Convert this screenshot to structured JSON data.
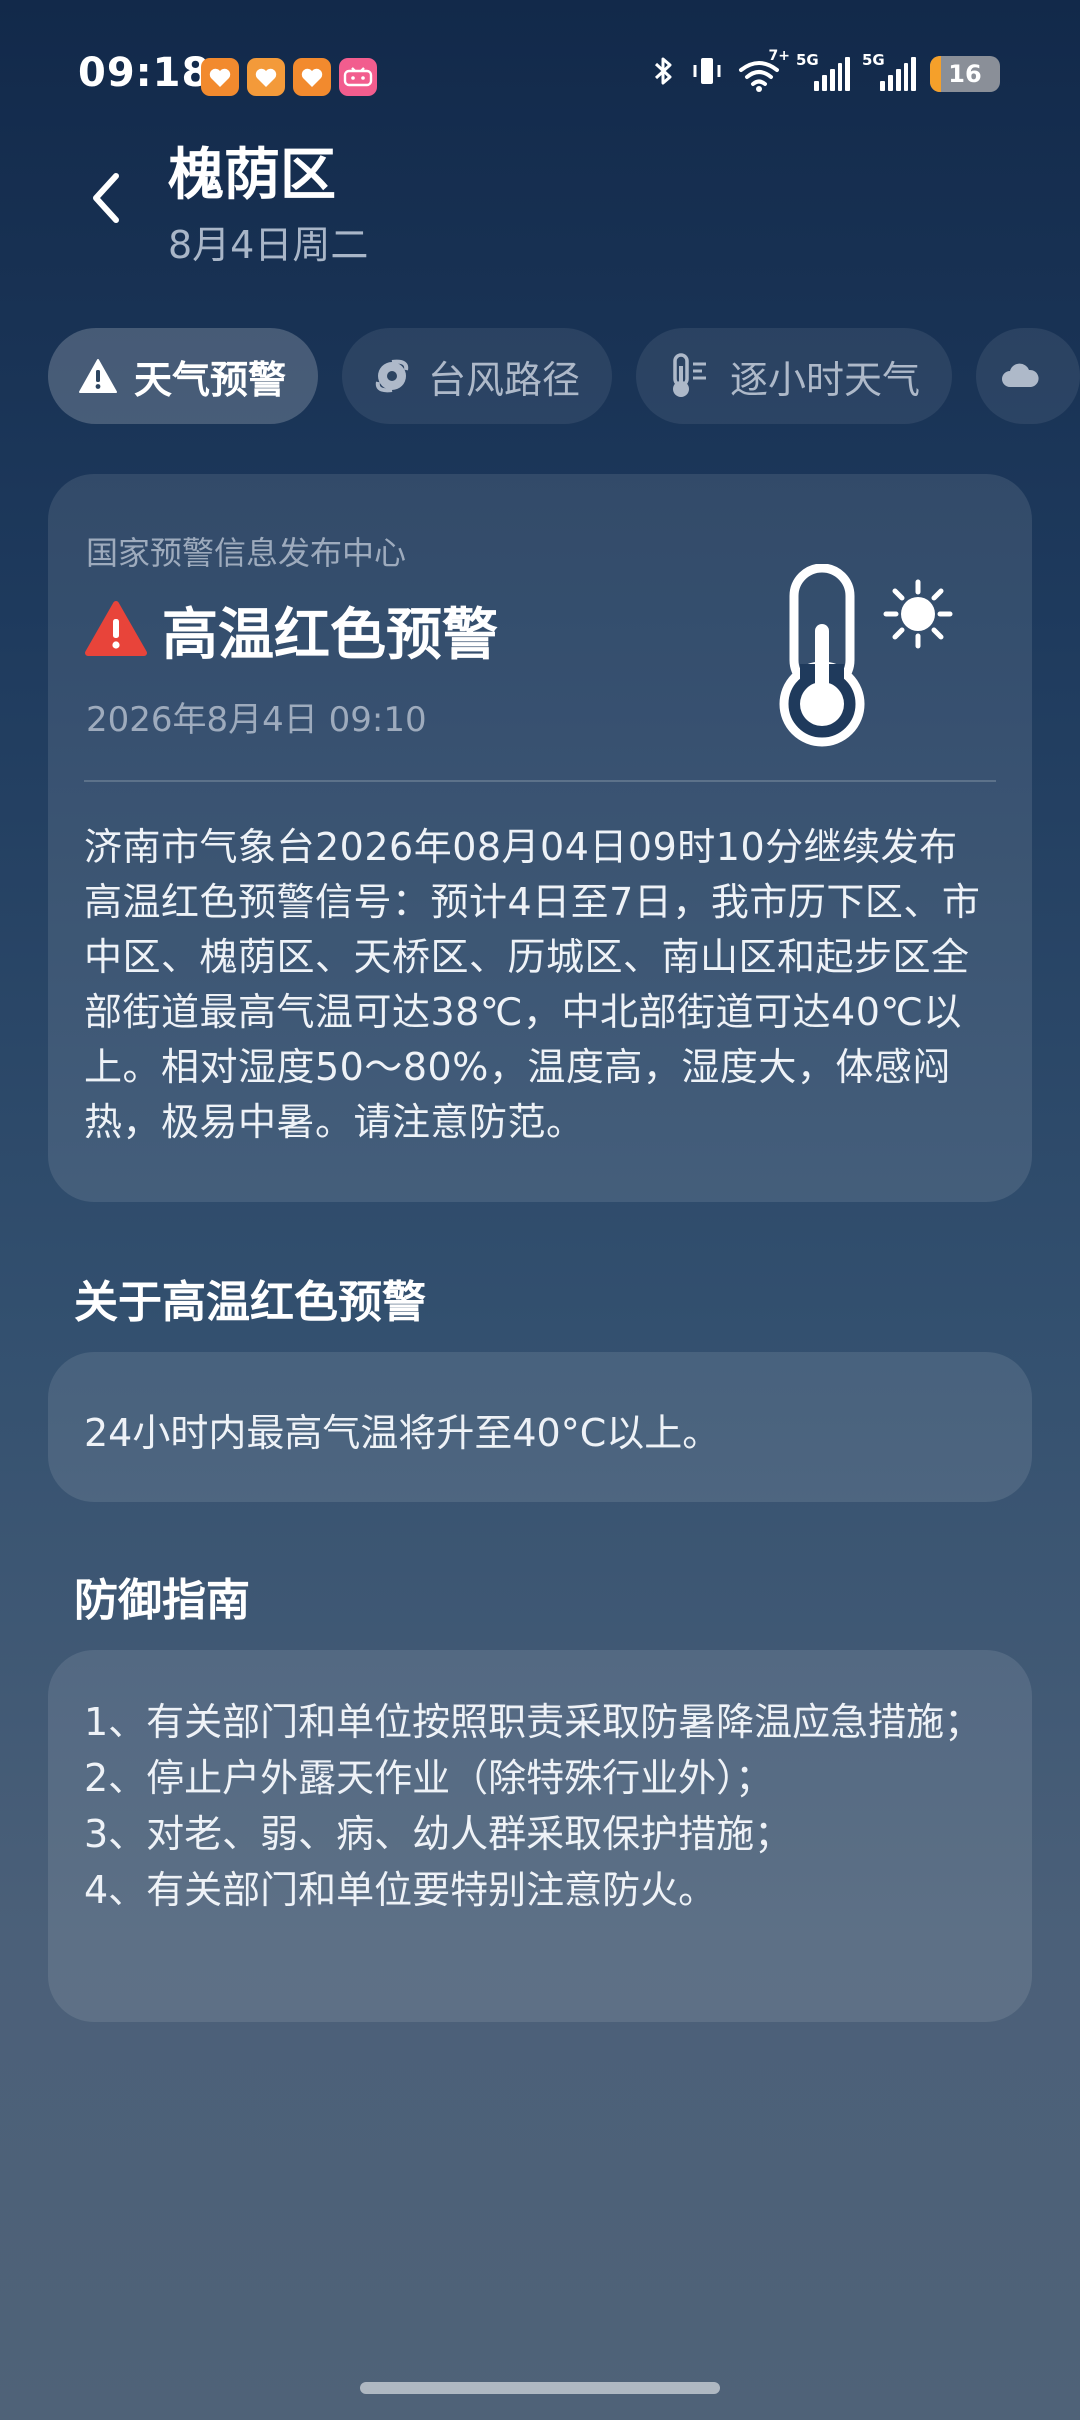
{
  "status_bar": {
    "time": "09:18",
    "apps": [
      {
        "name": "app-heart-1",
        "color": "#f28a2e",
        "glyph": "♥"
      },
      {
        "name": "app-heart-2",
        "color": "#f39a3a",
        "glyph": "♥"
      },
      {
        "name": "app-heart-3",
        "color": "#f28a2e",
        "glyph": "♥"
      },
      {
        "name": "bilibili",
        "color": "#f25d8e",
        "glyph": "bili"
      }
    ],
    "wifi_label": "7+",
    "signal_1_label": "5G",
    "signal_2_label": "5G",
    "battery_level": "16",
    "battery_fraction": 0.16
  },
  "header": {
    "title": "槐荫区",
    "subtitle": "8月4日周二"
  },
  "tabs": [
    {
      "label": "天气预警",
      "icon": "warning-icon",
      "active": true
    },
    {
      "label": "台风路径",
      "icon": "typhoon-icon",
      "active": false
    },
    {
      "label": "逐小时天气",
      "icon": "thermometer-icon",
      "active": false
    },
    {
      "label": "",
      "icon": "cloud-icon",
      "active": false
    }
  ],
  "warning": {
    "issuer": "国家预警信息发布中心",
    "title": "高温红色预警",
    "time": "2026年8月4日 09:10",
    "body": "济南市气象台2026年08月04日09时10分继续发布高温红色预警信号：预计4日至7日，我市历下区、市中区、槐荫区、天桥区、历城区、南山区和起步区全部街道最高气温可达38℃，中北部街道可达40℃以上。相对湿度50～80%，温度高，湿度大，体感闷热，极易中暑。请注意防范。",
    "alert_color": "#e8443a"
  },
  "about": {
    "heading": "关于高温红色预警",
    "text": "24小时内最高气温将升至40°C以上。"
  },
  "guide": {
    "heading": "防御指南",
    "items": [
      "1、有关部门和单位按照职责采取防暑降温应急措施；",
      "2、停止户外露天作业（除特殊行业外）；",
      "3、对老、弱、病、幼人群采取保护措施；",
      "4、有关部门和单位要特别注意防火。"
    ]
  }
}
